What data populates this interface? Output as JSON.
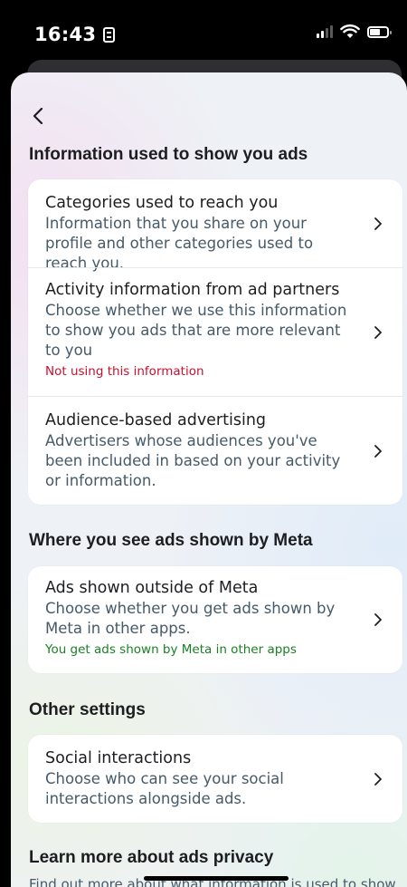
{
  "status_bar": {
    "time": "16:43"
  },
  "nav": {
    "back_label": "Back"
  },
  "sections": {
    "info": {
      "heading": "Information used to show you ads",
      "items": [
        {
          "title": "Categories used to reach you",
          "desc": "Information that you share on your profile and other categories used to reach you."
        },
        {
          "title": "Activity information from ad partners",
          "desc": "Choose whether we use this information to show you ads that are more relevant to you",
          "status": "Not using this information"
        },
        {
          "title": "Audience-based advertising",
          "desc": "Advertisers whose audiences you've been included in based on your activity or information."
        }
      ]
    },
    "where": {
      "heading": "Where you see ads shown by Meta",
      "items": [
        {
          "title": "Ads shown outside of Meta",
          "desc": "Choose whether you get ads shown by Meta in other apps.",
          "status": "You get ads shown by Meta in other apps"
        }
      ]
    },
    "other": {
      "heading": "Other settings",
      "items": [
        {
          "title": "Social interactions",
          "desc": "Choose who can see your social interactions alongside ads."
        }
      ]
    },
    "learn": {
      "heading": "Learn more about ads privacy",
      "desc": "Find out more about what information is used to show"
    }
  },
  "colors": {
    "status_red": "#c8102e",
    "status_green": "#1a7f24",
    "card_bg": "#ffffff"
  },
  "icons": {
    "back": "chevron-left-icon",
    "row": "chevron-right-icon"
  }
}
